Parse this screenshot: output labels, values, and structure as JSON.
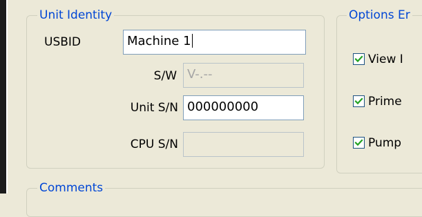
{
  "unit_identity": {
    "title": "Unit Identity",
    "usbid": {
      "label": "USBID",
      "value": "Machine 1"
    },
    "sw": {
      "label": "S/W",
      "value": "V-.--"
    },
    "unit_sn": {
      "label": "Unit S/N",
      "value": "000000000"
    },
    "cpu_sn": {
      "label": "CPU S/N",
      "value": ""
    }
  },
  "options": {
    "title": "Options Er",
    "items": [
      {
        "label": "View I",
        "checked": true
      },
      {
        "label": "Prime",
        "checked": true
      },
      {
        "label": "Pump",
        "checked": true
      }
    ]
  },
  "comments": {
    "title": "Comments"
  },
  "colors": {
    "legend": "#0046d5",
    "check": "#21a121",
    "background": "#ece9d8"
  },
  "icons": {
    "checkbox": "check-mark-icon"
  }
}
